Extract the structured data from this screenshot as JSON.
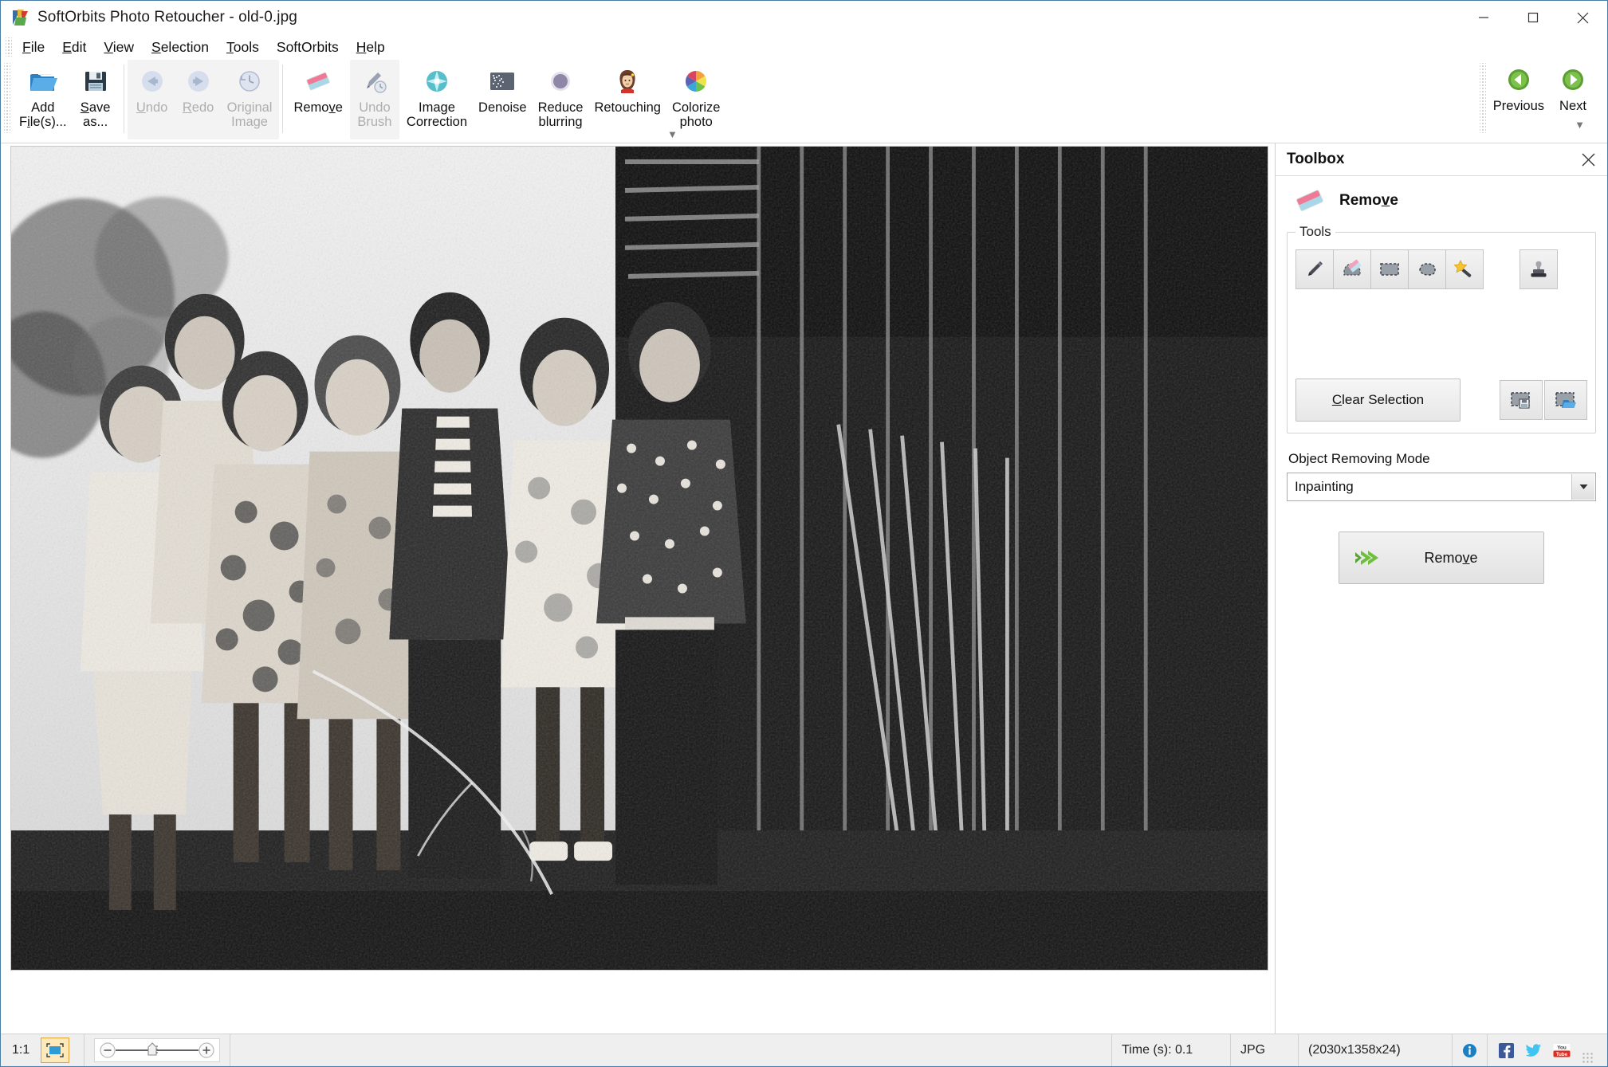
{
  "window": {
    "title": "SoftOrbits Photo Retoucher - old-0.jpg",
    "app_icon": "softorbits-logo-icon",
    "controls": {
      "minimize": "minimize-icon",
      "maximize": "maximize-icon",
      "close": "close-icon"
    }
  },
  "menu": {
    "items": [
      {
        "label": "File",
        "accel": "F"
      },
      {
        "label": "Edit",
        "accel": "E"
      },
      {
        "label": "View",
        "accel": "V"
      },
      {
        "label": "Selection",
        "accel": "S"
      },
      {
        "label": "Tools",
        "accel": "T"
      },
      {
        "label": "SoftOrbits",
        "accel": ""
      },
      {
        "label": "Help",
        "accel": "H"
      }
    ]
  },
  "ribbon": {
    "add_files": {
      "line1": "Add",
      "line2": "File(s)...",
      "accel": "i",
      "icon": "open-folder-icon",
      "disabled": false
    },
    "save_as": {
      "line1": "Save",
      "line2": "as...",
      "accel": "S",
      "icon": "floppy-disk-icon",
      "disabled": false
    },
    "undo": {
      "line1": "Undo",
      "line2": "",
      "accel": "U",
      "icon": "undo-arrow-icon",
      "disabled": true
    },
    "redo": {
      "line1": "Redo",
      "line2": "",
      "accel": "R",
      "icon": "redo-arrow-icon",
      "disabled": true
    },
    "original_image": {
      "line1": "Original",
      "line2": "Image",
      "accel": "",
      "icon": "clock-history-icon",
      "disabled": true
    },
    "remove": {
      "line1": "Remove",
      "line2": "",
      "accel": "v",
      "icon": "eraser-icon",
      "disabled": false
    },
    "undo_brush": {
      "line1": "Undo",
      "line2": "Brush",
      "accel": "",
      "icon": "brush-history-icon",
      "disabled": true
    },
    "image_correction": {
      "line1": "Image",
      "line2": "Correction",
      "accel": "",
      "icon": "sparkle-gem-icon",
      "disabled": false
    },
    "denoise": {
      "line1": "Denoise",
      "line2": "",
      "accel": "",
      "icon": "noise-grid-icon",
      "disabled": false
    },
    "reduce_blurring": {
      "line1": "Reduce",
      "line2": "blurring",
      "accel": "",
      "icon": "blur-circle-icon",
      "disabled": false
    },
    "retouching": {
      "line1": "Retouching",
      "line2": "",
      "accel": "",
      "icon": "portrait-face-icon",
      "disabled": false
    },
    "colorize_photo": {
      "line1": "Colorize",
      "line2": "photo",
      "accel": "",
      "icon": "color-wheel-icon",
      "disabled": false
    },
    "previous": {
      "line1": "Previous",
      "line2": "",
      "accel": "",
      "icon": "green-left-arrow-icon",
      "disabled": false
    },
    "next": {
      "line1": "Next",
      "line2": "",
      "accel": "",
      "icon": "green-right-arrow-icon",
      "disabled": false
    },
    "overflow_icon": "chevron-down-icon"
  },
  "toolbox": {
    "panel_title": "Toolbox",
    "close_icon": "close-icon",
    "active_tool": {
      "label": "Remove",
      "accel": "v",
      "icon": "eraser-icon"
    },
    "tools_group_label": "Tools",
    "tools": [
      {
        "name": "pencil-tool",
        "icon": "pencil-icon",
        "selected": false
      },
      {
        "name": "eraser-tool",
        "icon": "eraser-brush-icon",
        "selected": false
      },
      {
        "name": "rectangle-select-tool",
        "icon": "rectangle-select-icon",
        "selected": false
      },
      {
        "name": "lasso-select-tool",
        "icon": "lasso-icon",
        "selected": false
      },
      {
        "name": "magic-wand-tool",
        "icon": "magic-wand-icon",
        "selected": false
      },
      {
        "name": "stamp-tool",
        "icon": "stamp-icon",
        "selected": false
      }
    ],
    "clear_selection": {
      "label": "Clear Selection",
      "accel": "C"
    },
    "save_selection_icon": "save-selection-icon",
    "load_selection_icon": "load-selection-icon",
    "object_removing_mode": {
      "label": "Object Removing Mode",
      "value": "Inpainting",
      "options": [
        "Inpainting"
      ],
      "arrow_icon": "chevron-down-icon"
    },
    "remove_action": {
      "label": "Remove",
      "accel": "v",
      "icon": "green-double-arrow-icon"
    }
  },
  "statusbar": {
    "zoom_ratio": "1:1",
    "fit_icon": "fit-to-window-icon",
    "zoom_out_icon": "zoom-out-icon",
    "zoom_in_icon": "zoom-in-icon",
    "time": "Time (s): 0.1",
    "format": "JPG",
    "dimensions": "(2030x1358x24)",
    "info_icon": "info-icon",
    "facebook_icon": "facebook-icon",
    "twitter_icon": "twitter-icon",
    "youtube_icon": "youtube-icon"
  },
  "colors": {
    "accent_blue": "#4a7ca8",
    "green": "#5aa84b",
    "eraser_pink": "#ef7a96",
    "eraser_blue": "#a8d8e8",
    "highlight_orange": "#e0a33a"
  }
}
